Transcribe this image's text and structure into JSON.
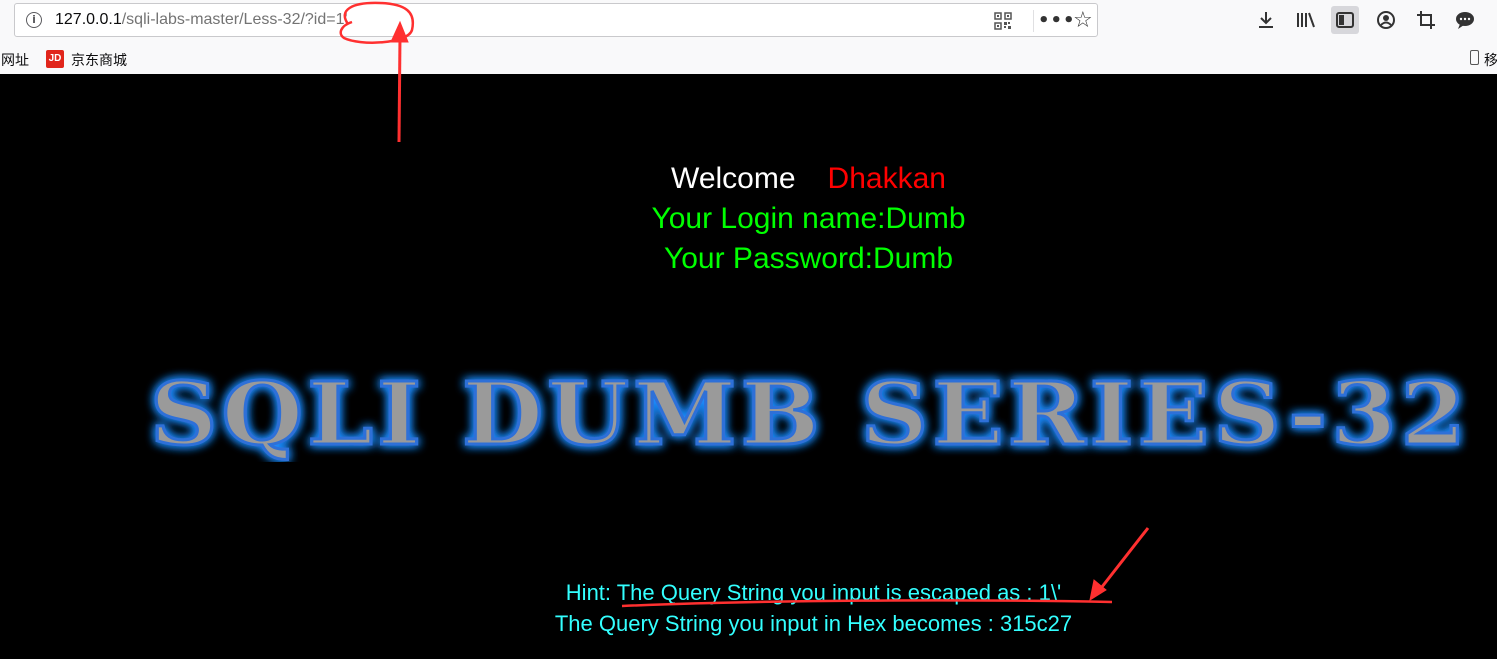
{
  "browser": {
    "url_host": "127.0.0.1",
    "url_path": "/sqli-labs-master/Less-32/?id=1'",
    "bookmarks": [
      {
        "label": "网址"
      },
      {
        "label": "京东商城",
        "icon_text": "JD"
      }
    ],
    "mobile_label": "移"
  },
  "page": {
    "welcome": "Welcome",
    "name": "Dhakkan",
    "login_line": "Your Login name:Dumb",
    "password_line": "Your Password:Dumb",
    "banner": "SQLI DUMB SERIES-32",
    "hint_line": "Hint: The Query String you input is escaped as : 1\\'",
    "hex_line": "The Query String you input in Hex becomes : 315c27"
  },
  "colors": {
    "welcome": "#ffffff",
    "name": "#ff0000",
    "credentials": "#00ff00",
    "hint": "#33ffff",
    "annotation": "#ff3030"
  }
}
